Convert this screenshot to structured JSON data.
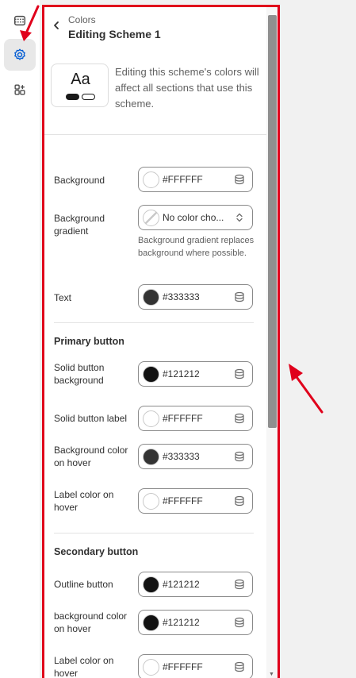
{
  "rail": {
    "items": [
      {
        "name": "sections-icon"
      },
      {
        "name": "settings-icon",
        "active": true
      },
      {
        "name": "apps-icon"
      }
    ]
  },
  "header": {
    "breadcrumb": "Colors",
    "title": "Editing Scheme 1"
  },
  "preview": {
    "sample": "Aa",
    "description": "Editing this scheme's colors will affect all sections that use this scheme."
  },
  "fields": {
    "background": {
      "label": "Background",
      "value": "#FFFFFF",
      "color": "#FFFFFF"
    },
    "background_gradient": {
      "label": "Background gradient",
      "value": "No color cho...",
      "help": "Background gradient replaces background where possible."
    },
    "text": {
      "label": "Text",
      "value": "#333333",
      "color": "#333333"
    }
  },
  "primary_button": {
    "title": "Primary button",
    "solid_background": {
      "label": "Solid button background",
      "value": "#121212",
      "color": "#121212"
    },
    "solid_label": {
      "label": "Solid button label",
      "value": "#FFFFFF",
      "color": "#FFFFFF"
    },
    "background_hover": {
      "label": "Background color on hover",
      "value": "#333333",
      "color": "#333333"
    },
    "label_hover": {
      "label": "Label color on hover",
      "value": "#FFFFFF",
      "color": "#FFFFFF"
    }
  },
  "secondary_button": {
    "title": "Secondary button",
    "outline": {
      "label": "Outline button",
      "value": "#121212",
      "color": "#121212"
    },
    "background_hover": {
      "label": "background color on hover",
      "value": "#121212",
      "color": "#121212"
    },
    "label_hover": {
      "label": "Label color on hover",
      "value": "#FFFFFF",
      "color": "#FFFFFF"
    }
  },
  "colors": {
    "highlight": "#e0001b",
    "active_icon": "#005bd3"
  }
}
